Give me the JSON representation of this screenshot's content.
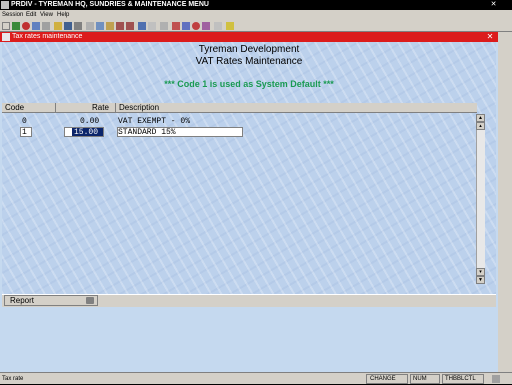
{
  "app": {
    "title": "PRDIV - TYREMAN HQ, SUNDRIES & MAINTENANCE MENU",
    "close_glyph": "✕"
  },
  "menubar": [
    "Session",
    "Edit",
    "View",
    "Help"
  ],
  "child_window": {
    "title": "Tax rates maintenance",
    "close_glyph": "✕"
  },
  "header": {
    "company": "Tyreman Development",
    "screen_title": "VAT Rates Maintenance",
    "note": "*** Code 1 is used as System Default ***"
  },
  "grid": {
    "columns": [
      "Code",
      "Rate",
      "Description"
    ],
    "rows": [
      {
        "code": "0",
        "rate": "0.00",
        "description": "VAT EXEMPT - 0%"
      },
      {
        "code": "1",
        "rate": "15.00",
        "description": "STANDARD 15%"
      }
    ]
  },
  "footer": {
    "report_label": "Report"
  },
  "status": {
    "left": "Tax rate",
    "mode": "CHANGE",
    "num": "NUM",
    "user": "THBBLCTL"
  },
  "colors": {
    "child_title": "#dc1c1c",
    "note": "#1a9a52",
    "selection": "#0a246a",
    "background": "#c5d9ef"
  }
}
